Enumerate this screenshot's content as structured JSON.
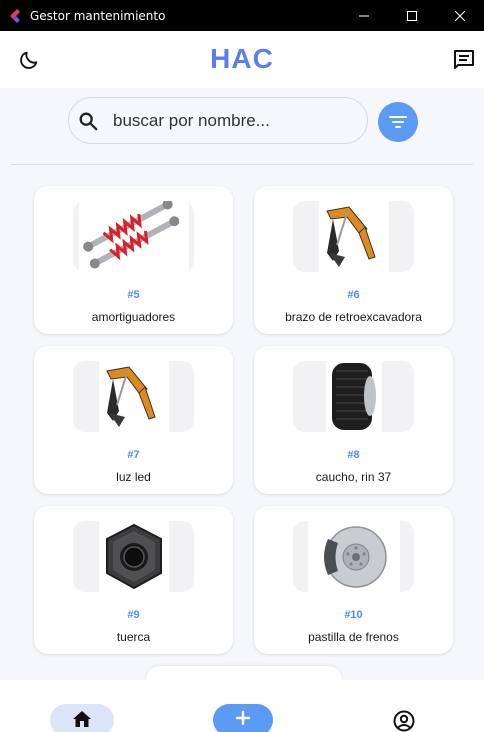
{
  "window": {
    "title": "Gestor mantenimiento"
  },
  "header": {
    "brand": "HAC"
  },
  "search": {
    "placeholder": "buscar por nombre..."
  },
  "items": [
    {
      "id": "#5",
      "name": "amortiguadores",
      "image": "shock-absorbers"
    },
    {
      "id": "#6",
      "name": "brazo de retroexcavadora",
      "image": "excavator-arm"
    },
    {
      "id": "#7",
      "name": "luz led",
      "image": "excavator-arm"
    },
    {
      "id": "#8",
      "name": "caucho, rin 37",
      "image": "tire"
    },
    {
      "id": "#9",
      "name": "tuerca",
      "image": "hex-nut"
    },
    {
      "id": "#10",
      "name": "pastilla de frenos",
      "image": "brake-disc"
    }
  ],
  "nav": {
    "home": "home-icon",
    "add": "plus-icon",
    "profile": "account-icon"
  },
  "colors": {
    "accent": "#5b9bf3",
    "brand_start": "#7a5cf0",
    "brand_end": "#3aa0f0",
    "id_text": "#4a8ef0",
    "background": "#f6f7fb"
  }
}
